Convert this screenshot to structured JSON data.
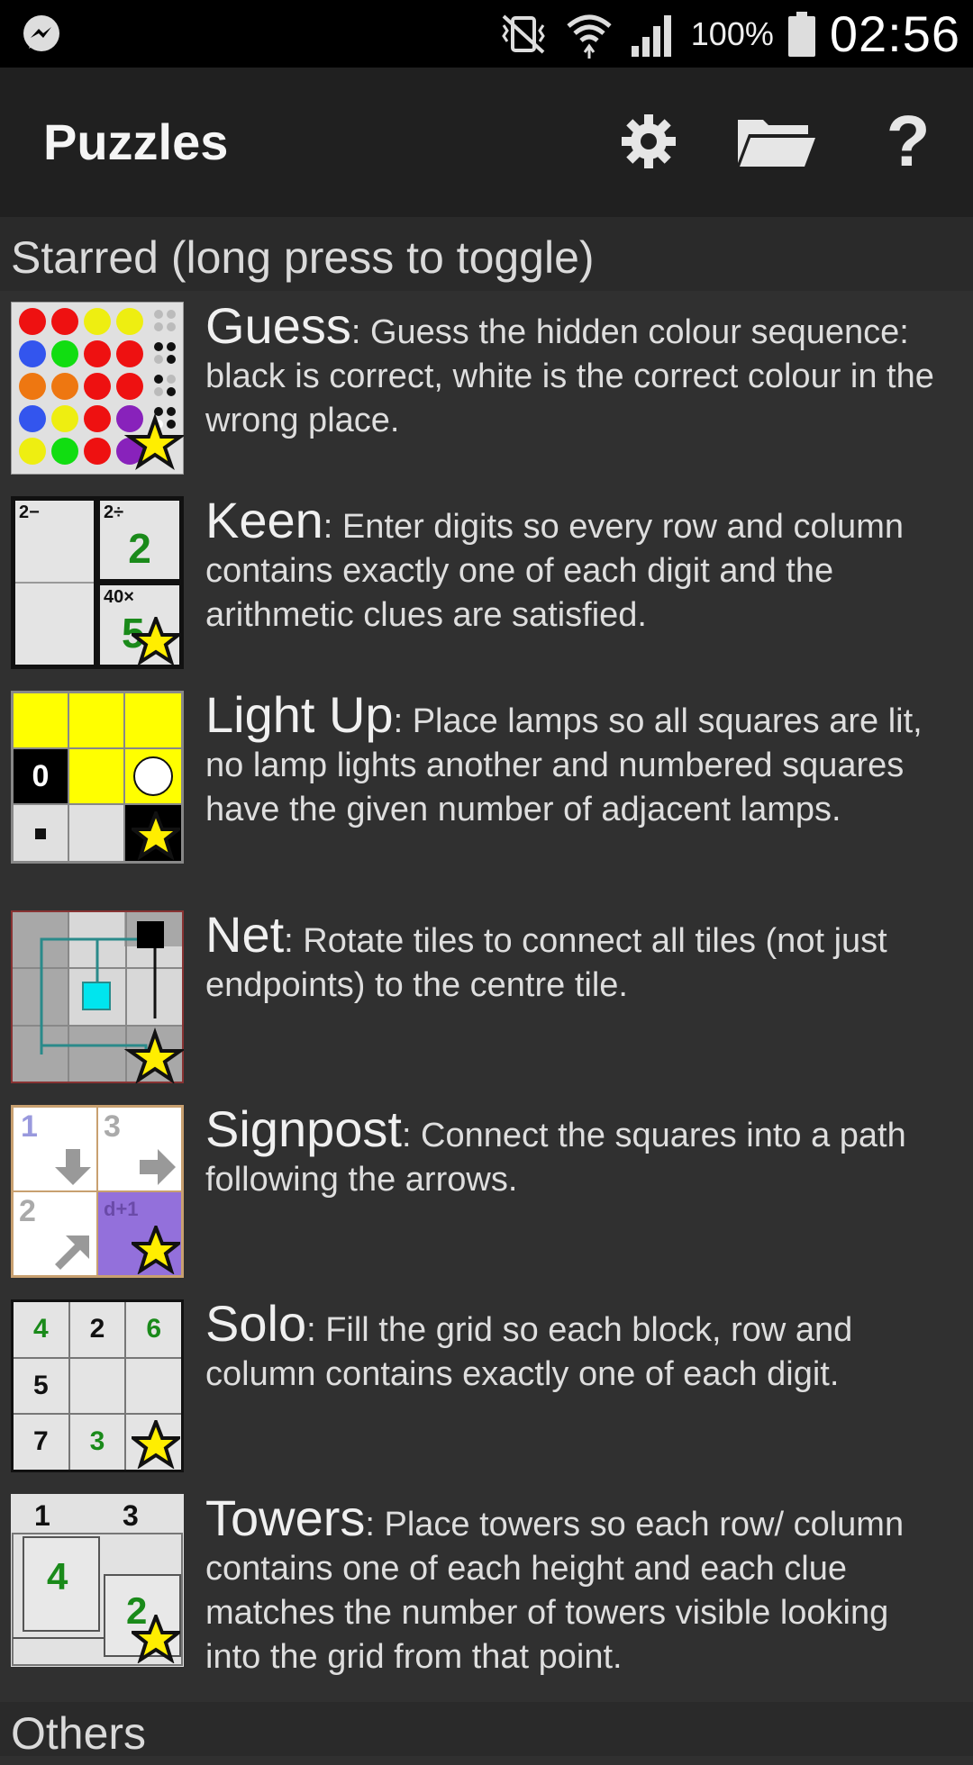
{
  "status_bar": {
    "battery_pct": "100%",
    "time": "02:56"
  },
  "app_bar": {
    "title": "Puzzles",
    "help_label": "?"
  },
  "sections": {
    "starred_header": "Starred (long press to toggle)",
    "others_header": "Others"
  },
  "puzzles": [
    {
      "name": "Guess",
      "desc": ": Guess the hidden colour sequence: black is correct, white is the correct colour in the wrong place."
    },
    {
      "name": "Keen",
      "desc": ": Enter digits so every row and column contains exactly one of each digit and the arithmetic clues are satisfied."
    },
    {
      "name": "Light Up",
      "desc": ": Place lamps so all squares are lit, no lamp lights another and numbered squares have the given number of adjacent lamps."
    },
    {
      "name": "Net",
      "desc": ": Rotate tiles to connect all tiles (not just endpoints) to the centre tile."
    },
    {
      "name": "Signpost",
      "desc": ": Connect the squares into a path following the arrows."
    },
    {
      "name": "Solo",
      "desc": ": Fill the grid so each block, row and column contains exactly one of each digit."
    },
    {
      "name": "Towers",
      "desc": ": Place towers so each row/ column contains one of each height and each clue matches the number of towers visible looking into the grid from that point."
    }
  ],
  "thumbs": {
    "keen": {
      "c1": "2−",
      "c2": "2÷",
      "v2": "2",
      "c4": "40×",
      "v4": "5"
    },
    "lightup": {
      "clue": "0"
    },
    "signpost": {
      "n1": "1",
      "n3": "3",
      "n2": "2",
      "d": "d+1"
    },
    "solo": [
      "4",
      "2",
      "6",
      "5",
      "",
      "",
      "7",
      "3",
      ""
    ],
    "towers": {
      "top1": "1",
      "top2": "3",
      "v1": "4",
      "v2": "2"
    }
  },
  "colors": {
    "background": "#303030",
    "app_bar": "#202020",
    "star_fill": "#ffee00",
    "given_green": "#1a8a1a"
  }
}
